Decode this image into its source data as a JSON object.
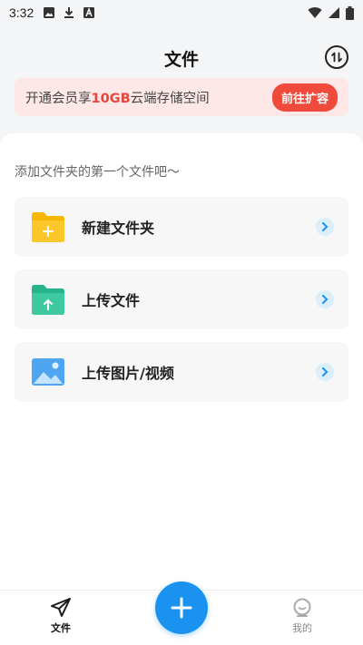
{
  "status_bar": {
    "time": "3:32",
    "left_icons": [
      "image-icon",
      "download-icon",
      "text-a-icon"
    ],
    "right_icons": [
      "wifi-icon",
      "signal-icon",
      "battery-icon"
    ]
  },
  "header": {
    "title": "文件",
    "transfer_icon": "transfer-icon"
  },
  "promo": {
    "text_before": "开通会员享",
    "text_highlight": "10GB",
    "text_after": "云端存储空间",
    "button_label": "前往扩容",
    "accent_color": "#ef4a3c"
  },
  "content": {
    "hint": "添加文件夹的第一个文件吧～",
    "actions": [
      {
        "label": "新建文件夹",
        "icon": "new-folder-icon"
      },
      {
        "label": "上传文件",
        "icon": "upload-file-icon"
      },
      {
        "label": "上传图片/视频",
        "icon": "upload-image-icon"
      }
    ]
  },
  "bottom_nav": {
    "items": [
      {
        "label": "文件",
        "icon": "paper-plane-icon",
        "active": true
      },
      {
        "label": "我的",
        "icon": "profile-icon",
        "active": false
      }
    ],
    "fab_icon": "plus-icon",
    "fab_color": "#1a93f0"
  }
}
